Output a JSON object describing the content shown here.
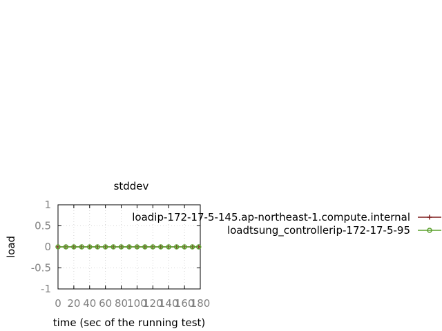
{
  "chart_data": {
    "type": "line",
    "title": "stddev",
    "xlabel": "time (sec of the running test)",
    "ylabel": "load",
    "xlim": [
      0,
      180
    ],
    "ylim": [
      -1,
      1
    ],
    "xticks": [
      0,
      20,
      40,
      60,
      80,
      100,
      120,
      140,
      160,
      180
    ],
    "yticks": [
      -1,
      -0.5,
      0,
      0.5,
      1
    ],
    "xtick_labels": [
      "0",
      "20",
      "40",
      "60",
      "80",
      "100",
      "120",
      "140",
      "160",
      "180"
    ],
    "ytick_labels": [
      "-1",
      "-0.5",
      "0",
      "0.5",
      "1"
    ],
    "grid": true,
    "legend_position": "right",
    "series": [
      {
        "name": "loadip-172-17-5-145.ap-northeast-1.compute.internal",
        "color": "#7f1d1d",
        "marker": "plus",
        "x": [
          0,
          10,
          20,
          30,
          40,
          50,
          60,
          70,
          80,
          90,
          100,
          110,
          120,
          130,
          140,
          150,
          160,
          170,
          178
        ],
        "values": [
          0,
          0,
          0,
          0,
          0,
          0,
          0,
          0,
          0,
          0,
          0,
          0,
          0,
          0,
          0,
          0,
          0,
          0,
          0
        ]
      },
      {
        "name": "loadtsung_controllerip-172-17-5-95",
        "color": "#5aa02c",
        "marker": "circle",
        "x": [
          0,
          10,
          20,
          30,
          40,
          50,
          60,
          70,
          80,
          90,
          100,
          110,
          120,
          130,
          140,
          150,
          160,
          170,
          178
        ],
        "values": [
          0,
          0,
          0,
          0,
          0,
          0,
          0,
          0,
          0,
          0,
          0,
          0,
          0,
          0,
          0,
          0,
          0,
          0,
          0
        ]
      }
    ]
  }
}
